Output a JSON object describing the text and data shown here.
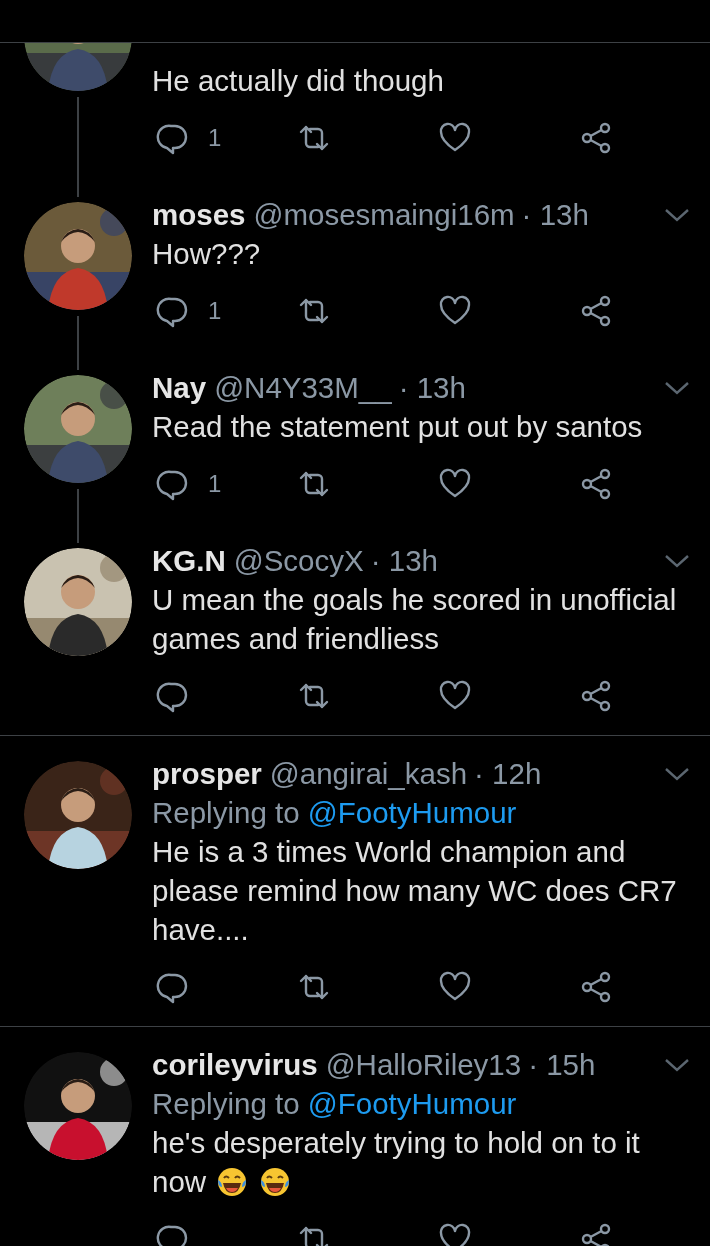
{
  "tweets": [
    {
      "partial": true,
      "text": "He actually did though",
      "reply_count": "1",
      "thread_down": true
    },
    {
      "partial": false,
      "name": "moses",
      "handle": "@mosesmaingi16m",
      "time": "· 13h",
      "text": "How???",
      "reply_count": "1",
      "thread_down": true
    },
    {
      "partial": false,
      "name": "Nay",
      "handle": "@N4Y33M__",
      "time": "· 13h",
      "text": "Read the statement put out by santos",
      "reply_count": "1",
      "thread_down": true
    },
    {
      "partial": false,
      "name": "KG.N",
      "handle": "@ScocyX",
      "time": "· 13h",
      "text": "U mean the goals he scored in unofficial games and friendliess",
      "thread_down": false
    },
    {
      "partial": false,
      "name": "prosper",
      "handle": "@angirai_kash",
      "time": "· 12h",
      "replying_label": "Replying to",
      "replying_to": "@FootyHumour",
      "text": "He is a 3 times World champion and please remind how many WC does CR7 have....",
      "thread_down": false
    },
    {
      "partial": false,
      "name": "corileyvirus",
      "handle": "@HalloRiley13",
      "time": "· 15h",
      "replying_label": "Replying to",
      "replying_to": "@FootyHumour",
      "text": "he's desperately trying to hold on to it now",
      "emoji": [
        {
          "kind": "laughing-tears"
        },
        {
          "kind": "laughing-tears"
        }
      ],
      "thread_down": false
    }
  ]
}
